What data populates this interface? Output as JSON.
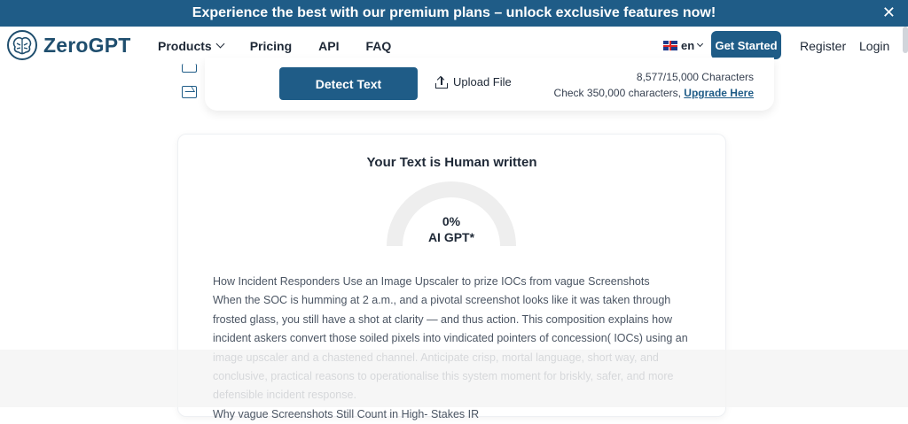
{
  "banner": {
    "text": "Experience the best with our premium plans – unlock exclusive features now!",
    "close": "✕"
  },
  "nav": {
    "logo": "ZeroGPT",
    "links": [
      "Products",
      "Pricing",
      "API",
      "FAQ"
    ],
    "language": "en",
    "cta": "Get Started",
    "register": "Register",
    "login": "Login"
  },
  "detector": {
    "detect_button": "Detect Text",
    "upload_label": "Upload File",
    "char_count": "8,577/15,000 Characters",
    "check_prefix": "Check 350,000 characters, ",
    "upgrade_link": "Upgrade Here"
  },
  "result": {
    "title": "Your Text is Human written",
    "percent": "0%",
    "percent_value": 0,
    "label": "AI GPT*",
    "paragraphs": [
      "How Incident Responders Use an Image Upscaler to prize IOCs from vague Screenshots",
      "When the SOC is humming at 2 a.m., and a pivotal screenshot looks like it was taken through frosted glass, you still have a shot at clarity — and thus action. This composition explains how incident askers convert those soiled pixels into vindicated pointers of concession( IOCs) using an image upscaler and a chastened channel. Anticipate crisp, mortal language, short way, and conclusive, practical reasons to operationalise this system moment for briskly, safer, and more defensible incident response.",
      "Why vague Screenshots Still Count in High- Stakes IR"
    ]
  },
  "colors": {
    "primary": "#1f5c87",
    "gauge_track": "#eeeeee"
  }
}
